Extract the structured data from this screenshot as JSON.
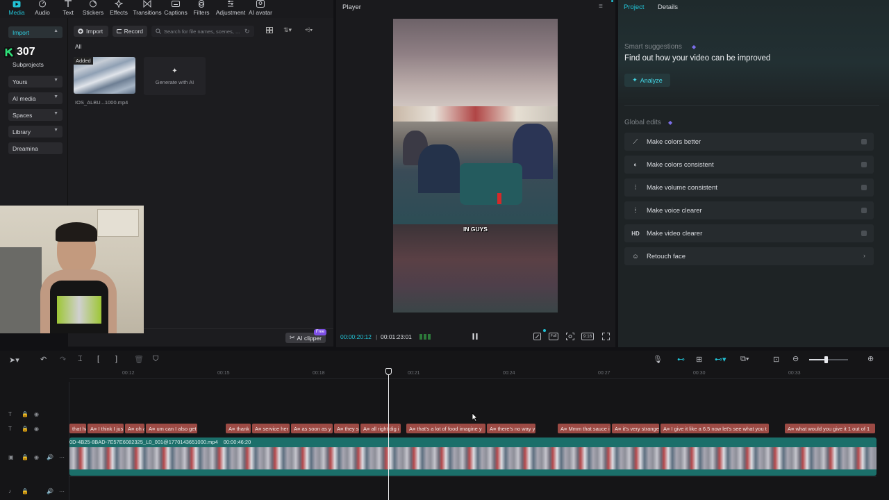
{
  "toolbar": {
    "items": [
      {
        "label": "Media",
        "icon": "media-icon",
        "active": true
      },
      {
        "label": "Audio",
        "icon": "audio-icon"
      },
      {
        "label": "Text",
        "icon": "text-icon"
      },
      {
        "label": "Stickers",
        "icon": "stickers-icon"
      },
      {
        "label": "Effects",
        "icon": "effects-icon"
      },
      {
        "label": "Transitions",
        "icon": "transitions-icon"
      },
      {
        "label": "Captions",
        "icon": "captions-icon"
      },
      {
        "label": "Filters",
        "icon": "filters-icon"
      },
      {
        "label": "Adjustment",
        "icon": "adjustment-icon"
      },
      {
        "label": "AI avatar",
        "icon": "ai-avatar-icon"
      }
    ]
  },
  "leftnav": {
    "import": "Import",
    "subprojects": "Subprojects",
    "counter": "307",
    "items": [
      "Yours",
      "AI media",
      "Spaces",
      "Library",
      "Dreamina"
    ]
  },
  "media": {
    "import_btn": "Import",
    "record_btn": "Record",
    "search_placeholder": "Search for file names, scenes, ...",
    "filter_all": "All",
    "clip_badge": "Added",
    "clip_name": "IOS_ALBU...1000.mp4",
    "generate_label": "Generate with AI",
    "ai_clipper": "AI clipper",
    "ai_clipper_badge": "Free"
  },
  "player": {
    "title": "Player",
    "subtitle_text": "IN GUYS",
    "current_time": "00:00:20:12",
    "total_time": "00:01:23:01",
    "ratio": "9:16",
    "full": "Full"
  },
  "right": {
    "tab_project": "Project",
    "tab_details": "Details",
    "smart_title": "Smart suggestions",
    "smart_heading": "Find out how your video can be improved",
    "analyze": "Analyze",
    "global_title": "Global edits",
    "edits": [
      {
        "label": "Make colors better",
        "icon": "magic-wand-icon"
      },
      {
        "label": "Make colors consistent",
        "icon": "palette-icon"
      },
      {
        "label": "Make volume consistent",
        "icon": "sliders-icon"
      },
      {
        "label": "Make voice clearer",
        "icon": "waveform-icon"
      },
      {
        "label": "Make video clearer",
        "icon": "hd-icon"
      },
      {
        "label": "Retouch face",
        "icon": "retouch-face-icon"
      }
    ]
  },
  "timeline": {
    "ticks": [
      "00:12",
      "00:15",
      "00:18",
      "00:21",
      "00:24",
      "00:27",
      "00:30",
      "00:33"
    ],
    "video_clip_label": "0D-4B25-8BAD-7E57E6082325_L0_001@1770143651000.mp4",
    "video_clip_duration": "00:00:46:20",
    "captions": [
      "that ha",
      "I think I jus",
      "oh a",
      "um can I also get",
      "thank",
      "service her",
      "as soon as y",
      "they s",
      "all right dig i",
      "that's a lot of food imagine y",
      "there's no way y",
      "Mmm that sauce i",
      "it's very strange",
      "I give it like a 6.5 now let's see what you t",
      "what would you give it 1 out of 1"
    ]
  },
  "colors": {
    "accent": "#22c3d6",
    "caption": "#9c4a44",
    "video_track": "#1b6f6a"
  }
}
